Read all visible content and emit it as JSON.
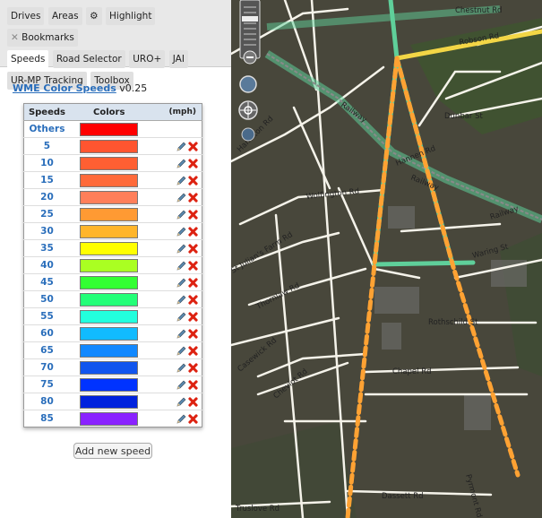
{
  "tabs": {
    "row1": [
      "Drives",
      "Areas",
      "⚙",
      "Highlight",
      "Bookmarks"
    ],
    "row2": [
      "Speeds",
      "Road Selector",
      "URO+",
      "JAI"
    ],
    "row3": [
      "UR-MP Tracking",
      "Toolbox"
    ]
  },
  "script": {
    "name": "WME Color Speeds",
    "version": "v0.25"
  },
  "table": {
    "col_speeds": "Speeds",
    "col_colors": "Colors",
    "col_unit": "(mph)",
    "rows": [
      {
        "speed": "Others",
        "color": "#ff0000",
        "editable": false
      },
      {
        "speed": "5",
        "color": "#ff5530",
        "editable": true
      },
      {
        "speed": "10",
        "color": "#ff5f32",
        "editable": true
      },
      {
        "speed": "15",
        "color": "#ff6a3a",
        "editable": true
      },
      {
        "speed": "20",
        "color": "#ff7f5a",
        "editable": true
      },
      {
        "speed": "25",
        "color": "#ff9a33",
        "editable": true
      },
      {
        "speed": "30",
        "color": "#ffb52a",
        "editable": true
      },
      {
        "speed": "35",
        "color": "#ffff00",
        "editable": true
      },
      {
        "speed": "40",
        "color": "#aaff22",
        "editable": true
      },
      {
        "speed": "45",
        "color": "#33ff33",
        "editable": true
      },
      {
        "speed": "50",
        "color": "#22ff77",
        "editable": true
      },
      {
        "speed": "55",
        "color": "#22ffdd",
        "editable": true
      },
      {
        "speed": "60",
        "color": "#11bbff",
        "editable": true
      },
      {
        "speed": "65",
        "color": "#1188ff",
        "editable": true
      },
      {
        "speed": "70",
        "color": "#1155ee",
        "editable": true
      },
      {
        "speed": "75",
        "color": "#0033ff",
        "editable": true
      },
      {
        "speed": "80",
        "color": "#0022dd",
        "editable": true
      },
      {
        "speed": "85",
        "color": "#8a22ff",
        "editable": true
      }
    ]
  },
  "add_button_label": "Add new speed",
  "map": {
    "labels": {
      "chestnut": "Chestnut Rd",
      "robson": "Robson Rd",
      "railway_top": "Railway",
      "dunbar": "Dunbar St",
      "hannen": "Hannen Rd",
      "railway_mid": "Railway",
      "railway_right": "Railway",
      "hamilton": "Hamilton Rd",
      "wolfington": "Wolfington Rd",
      "waring": "Waring St",
      "st_julians": "St Julian's Farm Rd",
      "thornlaw": "Thornlaw Rd",
      "rothschild": "Rothschild St",
      "casewick": "Casewick Rd",
      "chapel": "Chapel Rd",
      "cheviot": "Cheviot Rd",
      "dassett": "Dassett Rd",
      "truslove": "Truslove Rd",
      "pyrmont": "Pyrmont Rd"
    }
  }
}
